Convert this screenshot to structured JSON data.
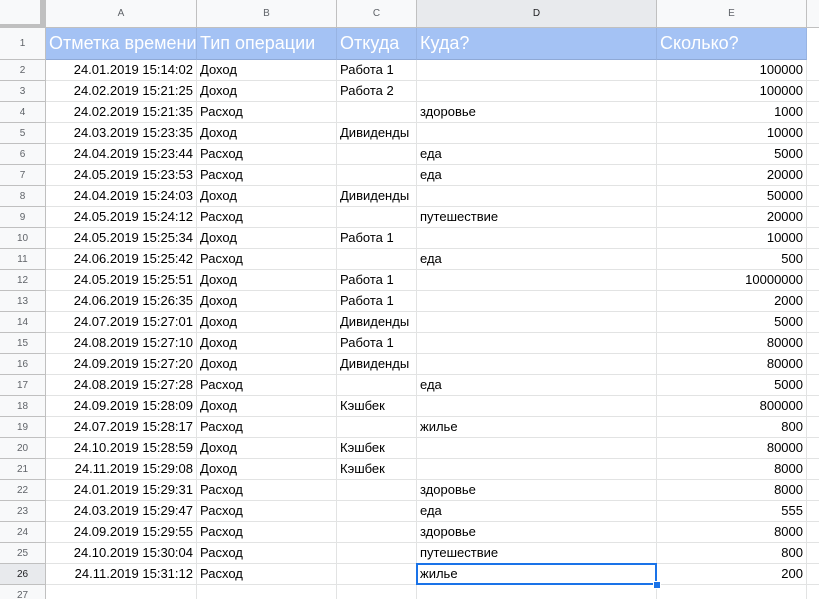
{
  "columns": [
    {
      "letter": "A",
      "align": "right"
    },
    {
      "letter": "B",
      "align": "left"
    },
    {
      "letter": "C",
      "align": "left"
    },
    {
      "letter": "D",
      "align": "left"
    },
    {
      "letter": "E",
      "align": "right"
    }
  ],
  "header_row": {
    "number": "1",
    "background": "#a4c2f4",
    "cells": [
      "Отметка времени",
      "Тип операции",
      "Откуда",
      "Куда?",
      "Сколько?"
    ]
  },
  "rows": [
    {
      "number": "2",
      "cells": [
        "24.01.2019 15:14:02",
        "Доход",
        "Работа 1",
        "",
        "100000"
      ]
    },
    {
      "number": "3",
      "cells": [
        "24.02.2019 15:21:25",
        "Доход",
        "Работа 2",
        "",
        "100000"
      ]
    },
    {
      "number": "4",
      "cells": [
        "24.02.2019 15:21:35",
        "Расход",
        "",
        "здоровье",
        "1000"
      ]
    },
    {
      "number": "5",
      "cells": [
        "24.03.2019 15:23:35",
        "Доход",
        "Дивиденды",
        "",
        "10000"
      ]
    },
    {
      "number": "6",
      "cells": [
        "24.04.2019 15:23:44",
        "Расход",
        "",
        "еда",
        "5000"
      ]
    },
    {
      "number": "7",
      "cells": [
        "24.05.2019 15:23:53",
        "Расход",
        "",
        "еда",
        "20000"
      ]
    },
    {
      "number": "8",
      "cells": [
        "24.04.2019 15:24:03",
        "Доход",
        "Дивиденды",
        "",
        "50000"
      ]
    },
    {
      "number": "9",
      "cells": [
        "24.05.2019 15:24:12",
        "Расход",
        "",
        "путешествие",
        "20000"
      ]
    },
    {
      "number": "10",
      "cells": [
        "24.05.2019 15:25:34",
        "Доход",
        "Работа 1",
        "",
        "10000"
      ]
    },
    {
      "number": "11",
      "cells": [
        "24.06.2019 15:25:42",
        "Расход",
        "",
        "еда",
        "500"
      ]
    },
    {
      "number": "12",
      "cells": [
        "24.05.2019 15:25:51",
        "Доход",
        "Работа 1",
        "",
        "10000000"
      ]
    },
    {
      "number": "13",
      "cells": [
        "24.06.2019 15:26:35",
        "Доход",
        "Работа 1",
        "",
        "2000"
      ]
    },
    {
      "number": "14",
      "cells": [
        "24.07.2019 15:27:01",
        "Доход",
        "Дивиденды",
        "",
        "5000"
      ]
    },
    {
      "number": "15",
      "cells": [
        "24.08.2019 15:27:10",
        "Доход",
        "Работа 1",
        "",
        "80000"
      ]
    },
    {
      "number": "16",
      "cells": [
        "24.09.2019 15:27:20",
        "Доход",
        "Дивиденды",
        "",
        "80000"
      ]
    },
    {
      "number": "17",
      "cells": [
        "24.08.2019 15:27:28",
        "Расход",
        "",
        "еда",
        "5000"
      ]
    },
    {
      "number": "18",
      "cells": [
        "24.09.2019 15:28:09",
        "Доход",
        "Кэшбек",
        "",
        "800000"
      ]
    },
    {
      "number": "19",
      "cells": [
        "24.07.2019 15:28:17",
        "Расход",
        "",
        "жилье",
        "800"
      ]
    },
    {
      "number": "20",
      "cells": [
        "24.10.2019 15:28:59",
        "Доход",
        "Кэшбек",
        "",
        "80000"
      ]
    },
    {
      "number": "21",
      "cells": [
        "24.11.2019 15:29:08",
        "Доход",
        "Кэшбек",
        "",
        "8000"
      ]
    },
    {
      "number": "22",
      "cells": [
        "24.01.2019 15:29:31",
        "Расход",
        "",
        "здоровье",
        "8000"
      ]
    },
    {
      "number": "23",
      "cells": [
        "24.03.2019 15:29:47",
        "Расход",
        "",
        "еда",
        "555"
      ]
    },
    {
      "number": "24",
      "cells": [
        "24.09.2019 15:29:55",
        "Расход",
        "",
        "здоровье",
        "8000"
      ]
    },
    {
      "number": "25",
      "cells": [
        "24.10.2019 15:30:04",
        "Расход",
        "",
        "путешествие",
        "800"
      ]
    },
    {
      "number": "26",
      "cells": [
        "24.11.2019 15:31:12",
        "Расход",
        "",
        "жилье",
        "200"
      ]
    },
    {
      "number": "27",
      "cells": [
        "",
        "",
        "",
        "",
        ""
      ]
    }
  ],
  "selection": {
    "row": "26",
    "column": "D",
    "color": "#1a73e8"
  }
}
